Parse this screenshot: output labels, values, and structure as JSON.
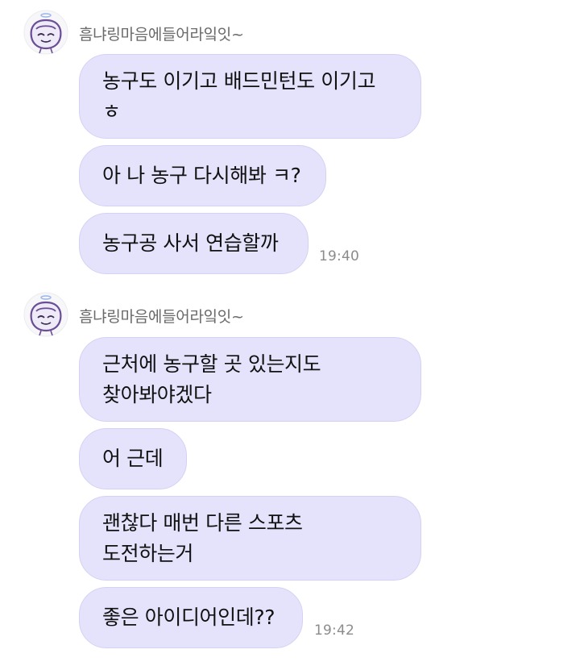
{
  "groups": [
    {
      "sender": "흠냐링마음에들어라잌잇~",
      "messages": [
        {
          "lines": [
            "농구도 이기고 배드민턴도 이기고",
            "ㅎ"
          ]
        },
        {
          "lines": [
            "아 나 농구 다시해봐 ㅋ?"
          ]
        },
        {
          "lines": [
            "농구공 사서 연습할까"
          ]
        }
      ],
      "time": "19:40"
    },
    {
      "sender": "흠냐링마음에들어라잌잇~",
      "messages": [
        {
          "lines": [
            "근처에 농구할 곳 있는지도",
            "찾아봐야겠다"
          ]
        },
        {
          "lines": [
            "어 근데"
          ]
        },
        {
          "lines": [
            "괜찮다 매번 다른 스포츠",
            "도전하는거"
          ]
        },
        {
          "lines": [
            "좋은 아이디어인데??"
          ]
        }
      ],
      "time": "19:42"
    }
  ]
}
